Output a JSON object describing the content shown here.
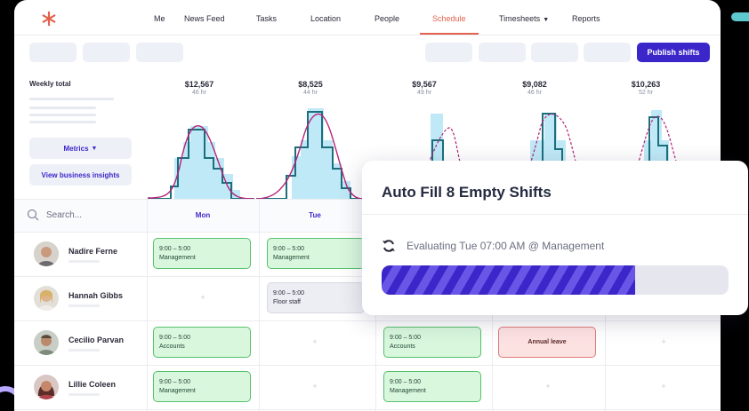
{
  "nav": {
    "logo_icon": "asterisk-logo-icon",
    "items": [
      {
        "label": "Me"
      },
      {
        "label": "News Feed"
      },
      {
        "label": "Tasks"
      },
      {
        "label": "Location"
      },
      {
        "label": "People"
      },
      {
        "label": "Schedule",
        "active": true
      },
      {
        "label": "Timesheets"
      },
      {
        "label": "Reports"
      }
    ]
  },
  "toolbar": {
    "publish_label": "Publish shifts"
  },
  "sidebar": {
    "weekly_total_label": "Weekly total",
    "metrics_label": "Metrics",
    "insights_label": "View business insights"
  },
  "days": [
    {
      "amount": "$12,567",
      "hours": "46 hr"
    },
    {
      "amount": "$8,525",
      "hours": "44 hr"
    },
    {
      "amount": "$9,567",
      "hours": "49 hr"
    },
    {
      "amount": "$9,082",
      "hours": "46 hr"
    },
    {
      "amount": "$10,263",
      "hours": "52 hr"
    }
  ],
  "grid": {
    "search_placeholder": "Search...",
    "day_labels": [
      "Mon",
      "Tue"
    ]
  },
  "employees": [
    {
      "name": "Nadire Ferne"
    },
    {
      "name": "Hannah Gibbs"
    },
    {
      "name": "Cecilio Parvan"
    },
    {
      "name": "Lillie Coleen"
    }
  ],
  "shifts": {
    "nadire_mon": {
      "time": "9:00 – 5:00",
      "role": "Management"
    },
    "nadire_tue": {
      "time": "9:00 – 5:00",
      "role": "Management"
    },
    "hannah_tue": {
      "time": "9:00 – 5:00",
      "role": "Floor staff"
    },
    "cecilio_mon": {
      "time": "9:00 – 5:00",
      "role": "Accounts"
    },
    "cecilio_wed": {
      "time": "9:00 – 5:00",
      "role": "Accounts"
    },
    "cecilio_thu": {
      "label": "Annual leave"
    },
    "lillie_mon": {
      "time": "9:00 – 5:00",
      "role": "Management"
    },
    "lillie_wed": {
      "time": "9:00 – 5:00",
      "role": "Management"
    }
  },
  "plus_glyph": "+",
  "modal": {
    "title": "Auto Fill 8 Empty Shifts",
    "status": "Evaluating Tue 07:00 AM @ Management",
    "progress": 0.73
  },
  "colors": {
    "accent": "#3b27c9",
    "nav_active": "#e2624e",
    "shift_green": "#d8f7dc",
    "leave_red": "#fde2e2",
    "chart_bar": "#bfe9f7",
    "chart_step": "#1d6e7c",
    "chart_curve": "#b4237a"
  }
}
